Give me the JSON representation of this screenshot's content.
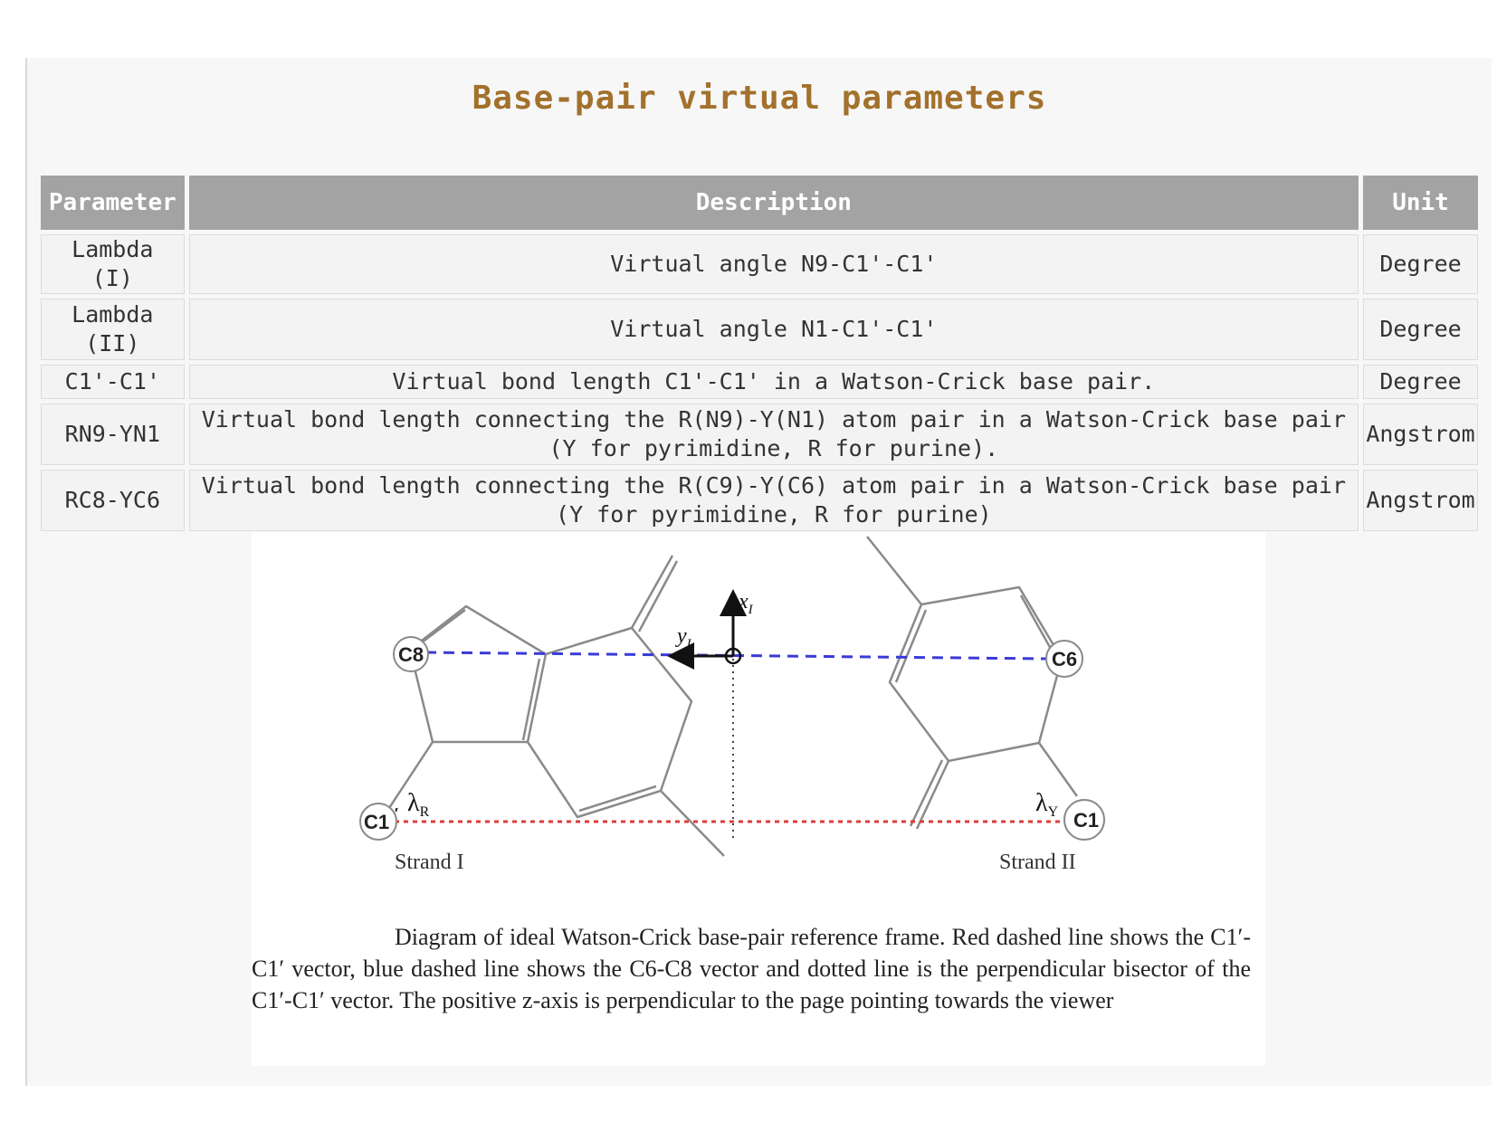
{
  "page": {
    "title": "Base-pair virtual parameters"
  },
  "table": {
    "headers": [
      "Parameter",
      "Description",
      "Unit"
    ],
    "rows": [
      {
        "parameter": "Lambda (I)",
        "description": "Virtual angle N9-C1'-C1'",
        "unit": "Degree"
      },
      {
        "parameter": "Lambda (II)",
        "description": "Virtual angle N1-C1'-C1'",
        "unit": "Degree"
      },
      {
        "parameter": "C1'-C1'",
        "description": "Virtual bond length C1'-C1' in a Watson-Crick base pair.",
        "unit": "Degree"
      },
      {
        "parameter": "RN9-YN1",
        "description": "Virtual bond length connecting the R(N9)-Y(N1) atom pair in a Watson-Crick base pair (Y for pyrimidine, R for purine).",
        "unit": "Angstrom"
      },
      {
        "parameter": "RC8-YC6",
        "description": "Virtual bond length connecting the R(C9)-Y(C6) atom pair in a Watson-Crick base pair (Y for pyrimidine, R for purine)",
        "unit": "Angstrom"
      }
    ]
  },
  "figure": {
    "labels": {
      "c8": "C8",
      "c6": "C6",
      "c1_left": "C1",
      "c1_right": "C1",
      "lambda_r": "λ",
      "lambda_r_sub": "R",
      "lambda_y": "λ",
      "lambda_y_sub": "Y",
      "x_axis": "x",
      "x_axis_sub": "I",
      "y_axis": "y",
      "y_axis_sub": "I",
      "strand_1": "Strand I",
      "strand_2": "Strand II"
    },
    "colors": {
      "blue_line": "#3a3ad8",
      "red_line": "#e03a3a",
      "structure": "#8a8a8a"
    },
    "caption": "Diagram of ideal Watson-Crick base-pair reference frame. Red dashed line shows the C1′-C1′ vector, blue dashed line shows the C6-C8 vector and dotted line is the perpendicular bisector of the C1′-C1′ vector. The positive z-axis is perpendicular to the page pointing towards the viewer"
  }
}
